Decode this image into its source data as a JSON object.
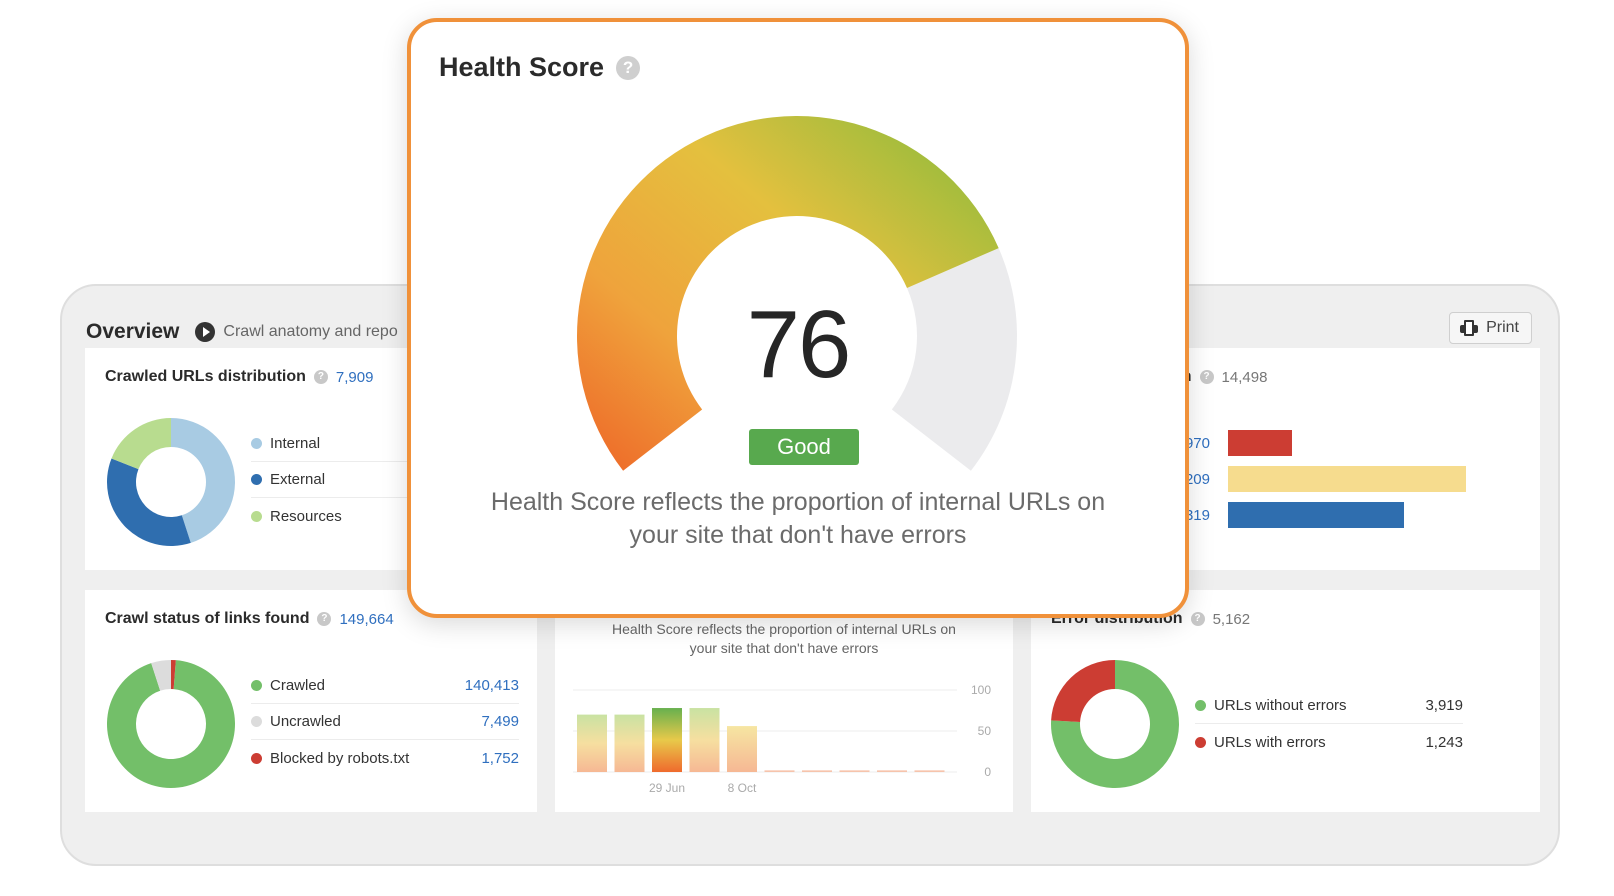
{
  "overview": {
    "title": "Overview",
    "subtitle": "Crawl anatomy and repo",
    "print_label": "Print"
  },
  "crawled_urls": {
    "title": "Crawled URLs distribution",
    "count": "7,909",
    "legend": [
      {
        "label": "Internal",
        "color": "#a8cbe3"
      },
      {
        "label": "External",
        "color": "#2f6eaf"
      },
      {
        "label": "Resources",
        "color": "#b8dc8f"
      }
    ],
    "slices": [
      0.45,
      0.36,
      0.19
    ]
  },
  "right_top": {
    "title_fragment": "on",
    "count": "14,498",
    "bars": [
      {
        "label": ",970",
        "color": "#cc3d33",
        "fraction": 0.27
      },
      {
        "label": ",209",
        "color": "#f6dc8e",
        "fraction": 1.0
      },
      {
        "label": ",319",
        "color": "#2f6eaf",
        "fraction": 0.74
      }
    ]
  },
  "crawl_status": {
    "title": "Crawl status of links found",
    "count": "149,664",
    "legend": [
      {
        "label": "Crawled",
        "value": "140,413",
        "color": "#73bf69"
      },
      {
        "label": "Uncrawled",
        "value": "7,499",
        "color": "#dcdcdc"
      },
      {
        "label": "Blocked by robots.txt",
        "value": "1,752",
        "color": "#cc3d33"
      }
    ],
    "slices": [
      0.938,
      0.05,
      0.012
    ]
  },
  "history": {
    "caption_line1": "Health Score reflects the proportion of internal URLs on",
    "caption_line2": "your site that don't have errors",
    "y_ticks": [
      "100",
      "50",
      "0"
    ],
    "x_labels": [
      "29 Jun",
      "8 Oct"
    ]
  },
  "chart_data": {
    "type": "bar",
    "title": "",
    "ylim": [
      0,
      100
    ],
    "x_labels": [
      "29 Jun",
      "8 Oct"
    ],
    "values": [
      70,
      70,
      78,
      78,
      56,
      2,
      2,
      2,
      2,
      2
    ]
  },
  "error_distribution": {
    "title": "Error distribution",
    "count": "5,162",
    "legend": [
      {
        "label": "URLs without errors",
        "value": "3,919",
        "color": "#73bf69"
      },
      {
        "label": "URLs with errors",
        "value": "1,243",
        "color": "#cc3d33"
      }
    ],
    "slices": [
      0.759,
      0.241
    ]
  },
  "health_score": {
    "title": "Health Score",
    "score": "76",
    "score_fraction": 0.76,
    "status": "Good",
    "description_line1": "Health Score reflects the proportion of internal URLs on",
    "description_line2": "your site that don't have errors"
  }
}
